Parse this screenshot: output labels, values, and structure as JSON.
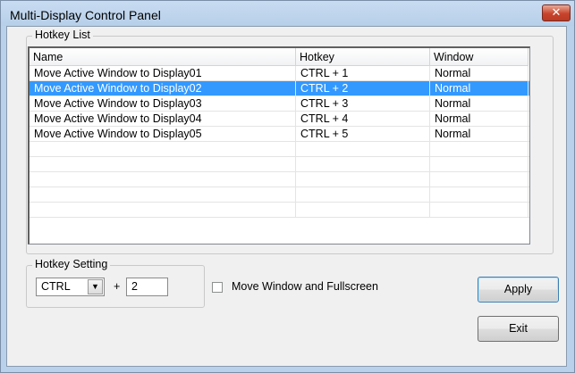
{
  "window": {
    "title": "Multi-Display Control Panel",
    "close_glyph": "✕"
  },
  "hotkey_list": {
    "legend": "Hotkey List",
    "columns": [
      "Name",
      "Hotkey",
      "Window"
    ],
    "rows": [
      {
        "name": "Move Active Window to Display01",
        "hotkey": "CTRL + 1",
        "window": "Normal"
      },
      {
        "name": "Move Active Window to Display02",
        "hotkey": "CTRL + 2",
        "window": "Normal"
      },
      {
        "name": "Move Active Window to Display03",
        "hotkey": "CTRL + 3",
        "window": "Normal"
      },
      {
        "name": "Move Active Window to Display04",
        "hotkey": "CTRL + 4",
        "window": "Normal"
      },
      {
        "name": "Move Active Window to Display05",
        "hotkey": "CTRL + 5",
        "window": "Normal"
      }
    ],
    "selected_index": 1
  },
  "hotkey_setting": {
    "legend": "Hotkey Setting",
    "modifier_value": "CTRL",
    "plus": "+",
    "key_value": "2",
    "checkbox_label": "Move Window and Fullscreen",
    "checkbox_checked": false
  },
  "buttons": {
    "apply": "Apply",
    "exit": "Exit"
  },
  "colors": {
    "selection": "#3399ff",
    "title_bar": "#b9d1ea",
    "close_button": "#c8432c"
  }
}
